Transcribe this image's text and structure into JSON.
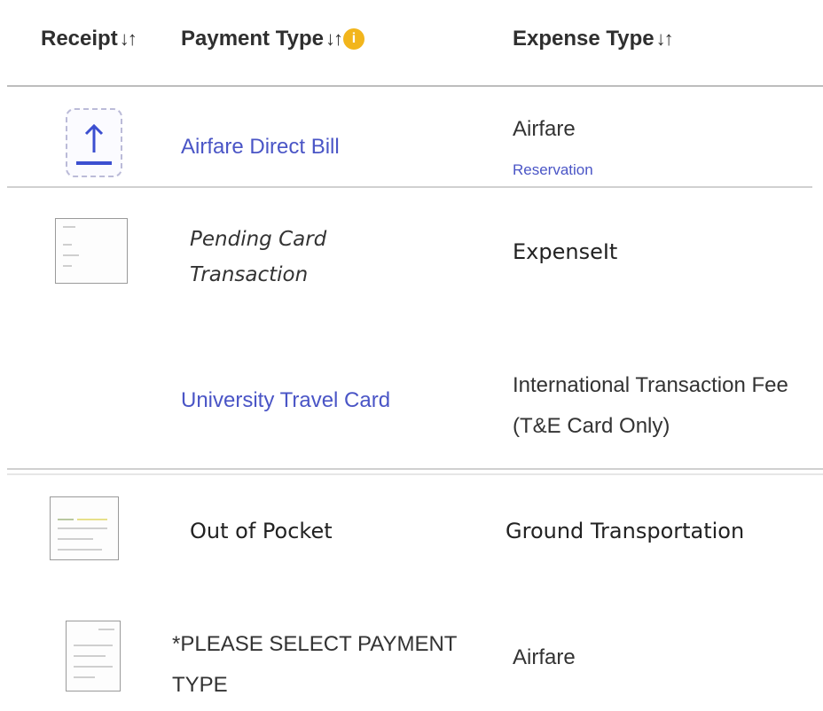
{
  "header": {
    "receipt": "Receipt",
    "payment_type": "Payment Type",
    "expense_type": "Expense Type",
    "sort_icon": "sort-arrows-icon",
    "info_icon": "info-icon",
    "info_glyph": "i",
    "info_color": "#f2b51c"
  },
  "rows": [
    {
      "receipt": "upload-icon",
      "payment_type": "Airfare Direct Bill",
      "expense_type": "Airfare",
      "expense_sub": "Reservation"
    },
    {
      "receipt": "receipt-thumbnail",
      "payment_type": "Pending Card Transaction",
      "payment_line1": "Pending Card",
      "payment_line2": "Transaction",
      "expense_type": "ExpenseIt"
    },
    {
      "receipt": "",
      "payment_type": "University Travel Card",
      "expense_line1": "International Transaction Fee",
      "expense_line2": "(T&E Card Only)"
    },
    {
      "receipt": "receipt-thumbnail",
      "payment_type": "Out of Pocket",
      "expense_type": "Ground Transportation"
    },
    {
      "receipt": "receipt-thumbnail",
      "payment_line1": "*PLEASE SELECT PAYMENT",
      "payment_line2": "TYPE",
      "expense_type": "Airfare"
    }
  ],
  "colors": {
    "link": "#4a55c6",
    "text": "#333333"
  }
}
